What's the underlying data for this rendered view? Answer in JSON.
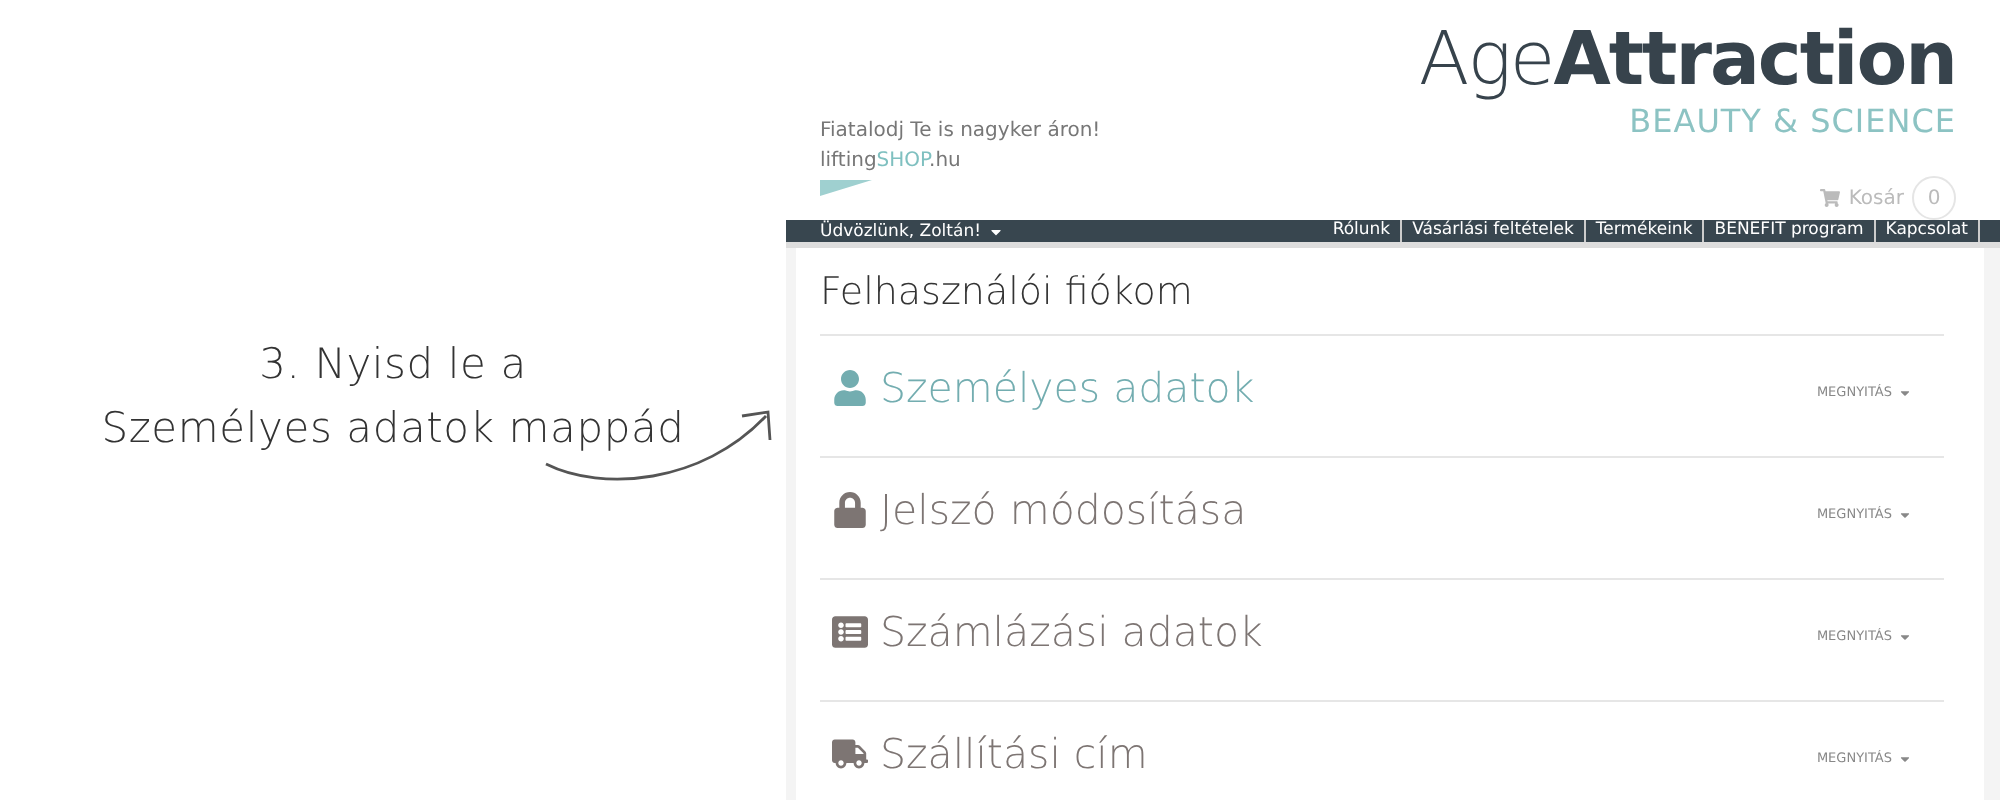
{
  "annotation": {
    "lines": [
      "3. Nyisd le a",
      "Személyes adatok mappád"
    ]
  },
  "header": {
    "tagline": "Fiatalodj Te is nagyker áron!",
    "site_name": [
      {
        "text": "lifting",
        "accent": false
      },
      {
        "text": "SHOP",
        "accent": true
      },
      {
        "text": ".hu",
        "accent": false
      }
    ],
    "logo": {
      "light": "Age",
      "bold": "Attraction",
      "subtitle": "BEAUTY & SCIENCE"
    },
    "cart": {
      "label": "Kosár",
      "count": "0"
    }
  },
  "navbar": {
    "greeting": "Üdvözlünk, Zoltán!",
    "links": [
      "Rólunk",
      "Vásárlási feltételek",
      "Termékeink",
      "BENEFIT program",
      "Kapcsolat"
    ]
  },
  "account": {
    "title": "Felhasználói fiókom",
    "sections": [
      {
        "kind": "user",
        "title": "Személyes adatok",
        "action": "MEGNYITÁS",
        "selected": true
      },
      {
        "kind": "lock",
        "title": "Jelszó módosítása",
        "action": "MEGNYITÁS",
        "selected": false
      },
      {
        "kind": "card",
        "title": "Számlázási adatok",
        "action": "MEGNYITÁS",
        "selected": false
      },
      {
        "kind": "truck",
        "title": "Szállítási cím",
        "action": "MEGNYITÁS",
        "selected": false
      }
    ]
  }
}
